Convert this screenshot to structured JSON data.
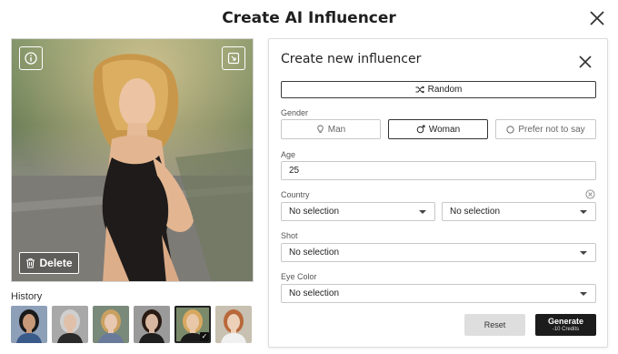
{
  "modal": {
    "title": "Create AI Influencer"
  },
  "preview": {
    "delete_label": "Delete"
  },
  "history": {
    "label": "History",
    "thumbnails": [
      {
        "skin": "#c89a7a",
        "hair": "#1a1a1a",
        "bg": "#8da0b8",
        "top": "#3a5a8a"
      },
      {
        "skin": "#e0c0a8",
        "hair": "#cfcfcf",
        "bg": "#a8a8a8",
        "top": "#2a2a2a"
      },
      {
        "skin": "#e8c8b0",
        "hair": "#c9a060",
        "bg": "#7a8a7a",
        "top": "#6a7a9a"
      },
      {
        "skin": "#d8b8a0",
        "hair": "#2a1a14",
        "bg": "#9a9a9a",
        "top": "#1e1e1e"
      },
      {
        "skin": "#e8c8a8",
        "hair": "#d8a860",
        "bg": "#7a8a6a",
        "top": "#1a1a1a"
      },
      {
        "skin": "#ecd0b8",
        "hair": "#b8683a",
        "bg": "#c8c0b0",
        "top": "#f0f0f0"
      }
    ],
    "selected_index": 4
  },
  "form": {
    "title": "Create new influencer",
    "random_label": "Random",
    "gender": {
      "label": "Gender",
      "options": [
        "Man",
        "Woman",
        "Prefer not to say"
      ],
      "selected": "Woman"
    },
    "age": {
      "label": "Age",
      "value": "25"
    },
    "country": {
      "label": "Country",
      "value_1": "No selection",
      "value_2": "No selection"
    },
    "shot": {
      "label": "Shot",
      "value": "No selection"
    },
    "eye_color": {
      "label": "Eye Color",
      "value": "No selection"
    },
    "reset_label": "Reset",
    "generate_label": "Generate",
    "generate_cost": "-10 Credits"
  }
}
